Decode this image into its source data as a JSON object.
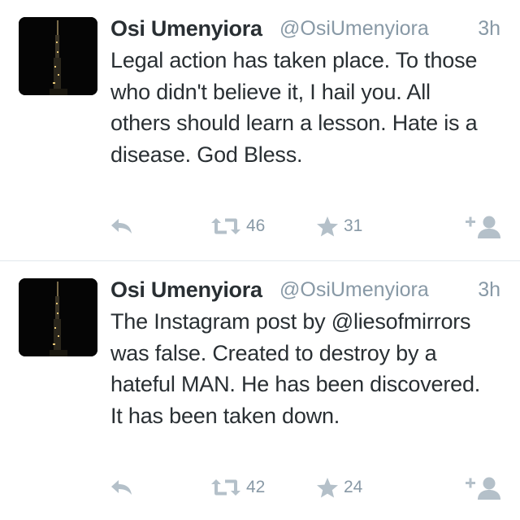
{
  "tweets": [
    {
      "name": "Osi Umenyiora",
      "handle": "@OsiUmenyiora",
      "time": "3h",
      "text": "Legal action has taken place. To those who didn't believe it, I hail you. All others should learn a lesson. Hate is a disease. God Bless.",
      "retweets": "46",
      "favorites": "31"
    },
    {
      "name": "Osi Umenyiora",
      "handle": "@OsiUmenyiora",
      "time": "3h",
      "text": "The Instagram post by @liesofmirrors was false. Created to destroy by a hateful MAN. He has been discovered. It has been taken down.",
      "retweets": "42",
      "favorites": "24"
    }
  ],
  "colors": {
    "text": "#292f33",
    "muted": "#8899a6",
    "icon": "#b4c0c9",
    "divider": "#e1e8ed"
  },
  "icons": {
    "reply": "reply-icon",
    "retweet": "retweet-icon",
    "favorite": "star-icon",
    "follow": "follow-icon"
  }
}
